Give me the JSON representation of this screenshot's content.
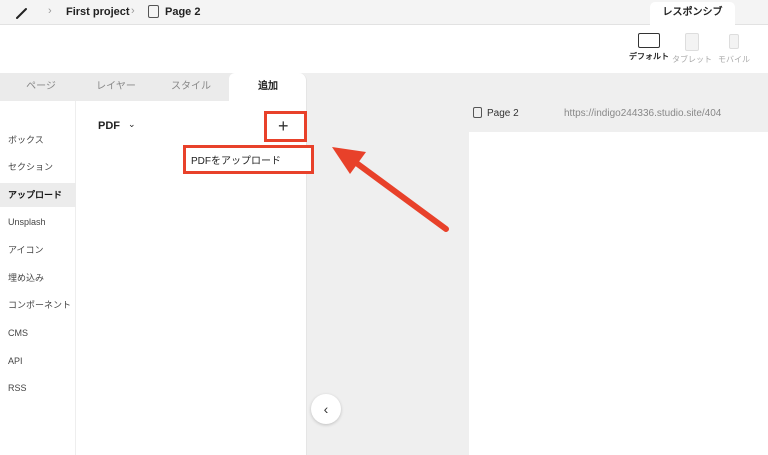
{
  "topbar": {
    "breadcrumb": [
      {
        "label": "First project"
      },
      {
        "label": "Page 2"
      }
    ],
    "responsive_tab": "レスポンシブ"
  },
  "devices": [
    {
      "label": "デフォルト",
      "icon": "monitor-icon",
      "active": true
    },
    {
      "label": "タブレット",
      "icon": "tablet-icon",
      "active": false
    },
    {
      "label": "モバイル",
      "icon": "mobile-icon",
      "active": false
    }
  ],
  "panel": {
    "tabs": [
      "ページ",
      "レイヤー",
      "スタイル",
      "追加"
    ],
    "active_tab": "追加",
    "nav": [
      "ボックス",
      "セクション",
      "アップロード",
      "Unsplash",
      "アイコン",
      "埋め込み",
      "コンポーネント",
      "CMS",
      "API",
      "RSS"
    ],
    "active_nav": "アップロード",
    "section_title": "PDF",
    "dropdown_item": "PDFをアップロード"
  },
  "canvas": {
    "page_name": "Page 2",
    "url": "https://indigo244336.studio.site/404"
  },
  "colors": {
    "highlight": "#e8412a"
  }
}
